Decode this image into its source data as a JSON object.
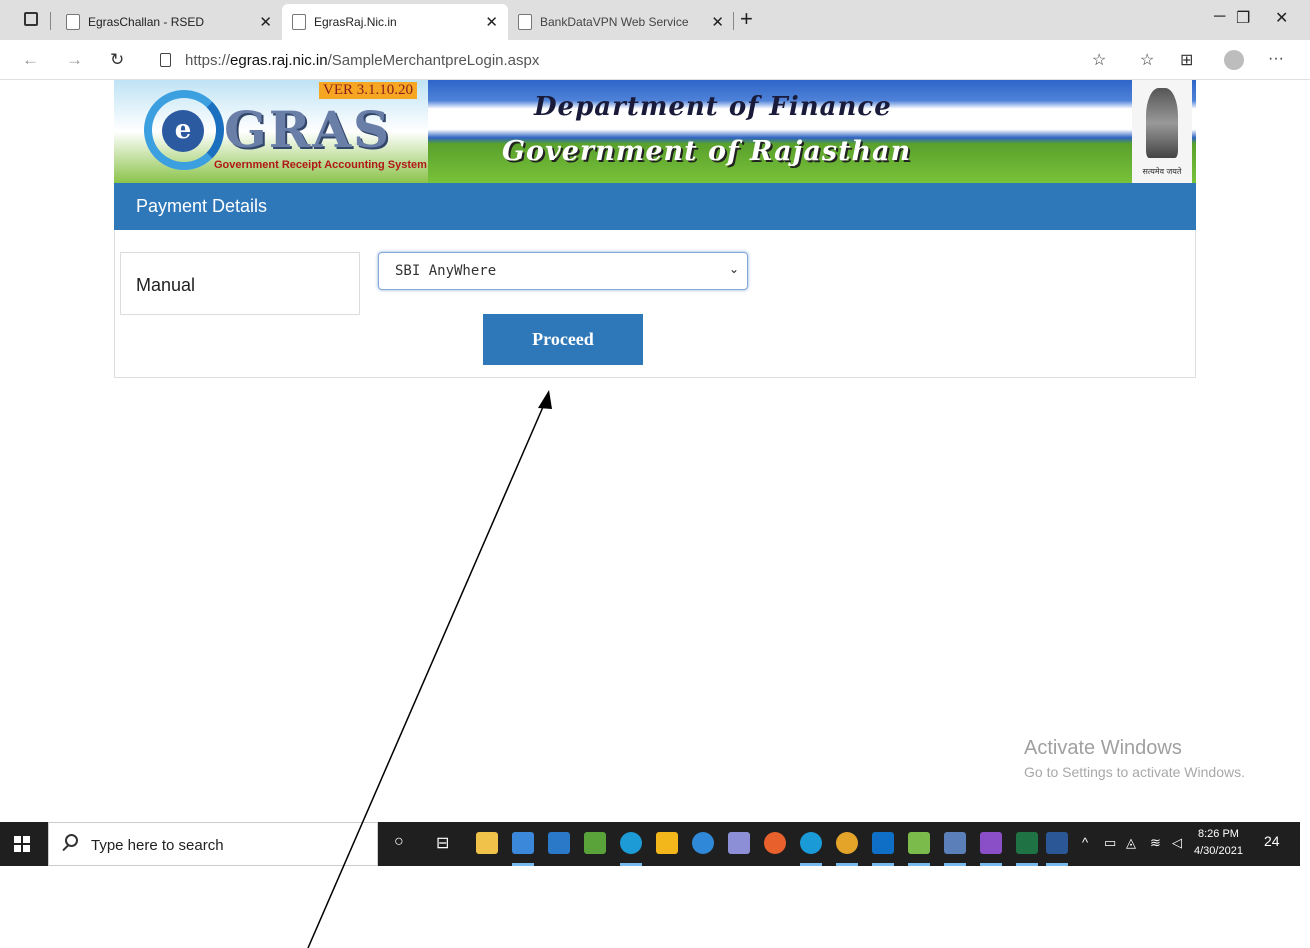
{
  "browser": {
    "tabs": [
      {
        "label": "EgrasChallan - RSED",
        "active": false
      },
      {
        "label": "EgrasRaj.Nic.in",
        "active": true
      },
      {
        "label": "BankDataVPN Web Service",
        "active": false
      }
    ],
    "url_prefix": "https://",
    "url_domain": "egras.raj.nic.in",
    "url_path": "/SampleMerchantpreLogin.aspx"
  },
  "header": {
    "version": "VER 3.1.10.20",
    "logo_text": "GRAS",
    "logo_letter": "e",
    "logo_subtitle": "Government Receipt Accounting System",
    "department": "Department of Finance",
    "government": "Government of Rajasthan",
    "emblem_motto": "सत्यमेव जयते"
  },
  "panel": {
    "title": "Payment Details",
    "manual_label": "Manual",
    "bank_select": {
      "selected": "SBI AnyWhere"
    },
    "proceed_label": "Proceed"
  },
  "watermark": {
    "line1": "Activate Windows",
    "line2": "Go to Settings to activate Windows."
  },
  "taskbar": {
    "search_placeholder": "Type here to search",
    "time": "8:26 PM",
    "date": "4/30/2021",
    "notification_count": "24"
  },
  "colors": {
    "panel_blue": "#2e77b8",
    "taskbar": "#1f1f1f"
  }
}
